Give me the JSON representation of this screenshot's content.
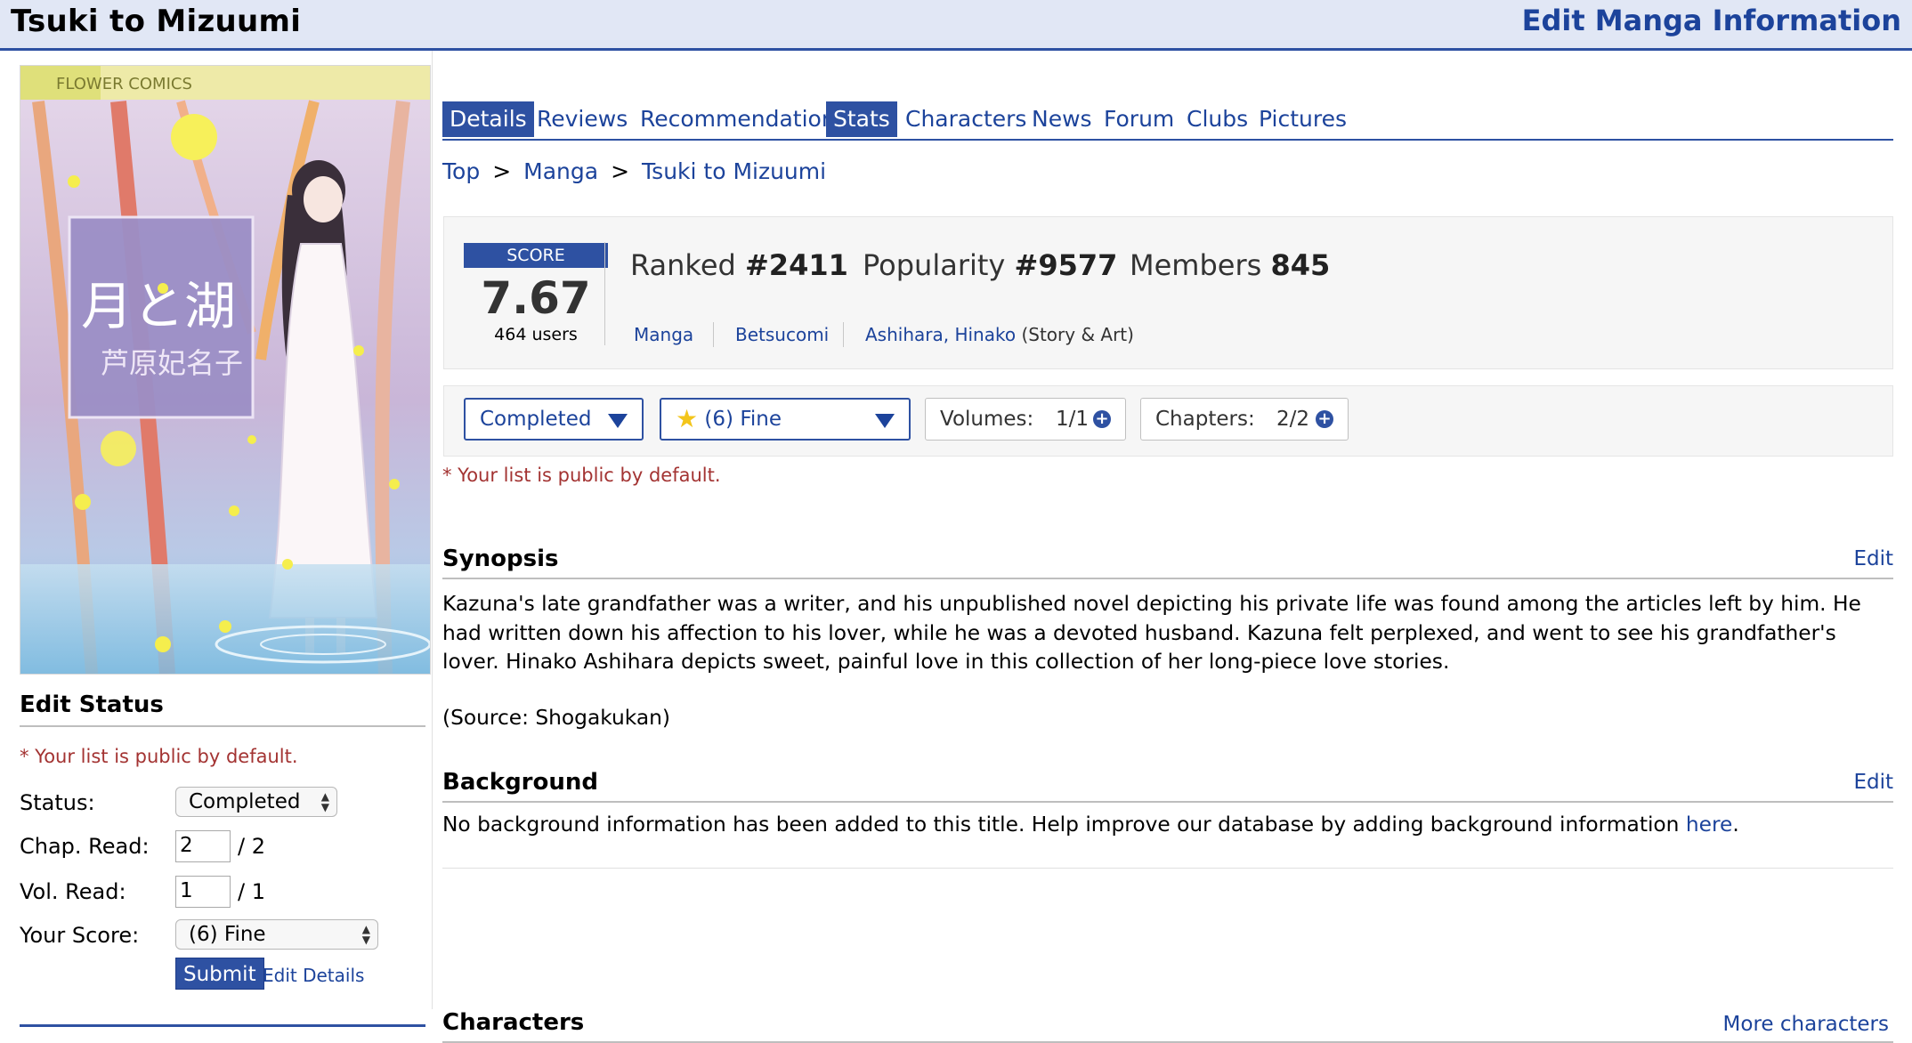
{
  "header": {
    "title": "Tsuki to Mizuumi",
    "edit_link": "Edit Manga Information"
  },
  "tabs": [
    {
      "label": "Details",
      "active": true
    },
    {
      "label": "Reviews",
      "active": false
    },
    {
      "label": "Recommendations",
      "active": false
    },
    {
      "label": "Stats",
      "active": true
    },
    {
      "label": "Characters",
      "active": false
    },
    {
      "label": "News",
      "active": false
    },
    {
      "label": "Forum",
      "active": false
    },
    {
      "label": "Clubs",
      "active": false
    },
    {
      "label": "Pictures",
      "active": false
    }
  ],
  "breadcrumb": {
    "top": "Top",
    "sep": ">",
    "manga": "Manga",
    "title": "Tsuki to Mizuumi"
  },
  "stats": {
    "score_label": "SCORE",
    "score": "7.67",
    "users": "464 users",
    "ranked_label": "Ranked",
    "ranked_value": "#2411",
    "popularity_label": "Popularity",
    "popularity_value": "#9577",
    "members_label": "Members",
    "members_value": "845",
    "type": "Manga",
    "serialization": "Betsucomi",
    "author": "Ashihara, Hinako",
    "author_role": "(Story & Art)"
  },
  "list_controls": {
    "status": "Completed",
    "score": "(6) Fine",
    "volumes_label": "Volumes:",
    "volumes_value": "1/1",
    "chapters_label": "Chapters:",
    "chapters_value": "2/2"
  },
  "public_note": "* Your list is public by default.",
  "cover": {
    "publisher_label": "FLOWER COMICS",
    "title_jp": "月と湖",
    "author_jp": "芦原妃名子"
  },
  "edit_status": {
    "title": "Edit Status",
    "public_note": "* Your list is public by default.",
    "status_label": "Status:",
    "status_value": "Completed",
    "chap_label": "Chap. Read:",
    "chap_value": "2",
    "chap_total": "/ 2",
    "vol_label": "Vol. Read:",
    "vol_value": "1",
    "vol_total": "/ 1",
    "score_label": "Your Score:",
    "score_value": "(6) Fine",
    "submit": "Submit",
    "edit_details": "Edit Details"
  },
  "synopsis": {
    "title": "Synopsis",
    "edit": "Edit",
    "text": "Kazuna's late grandfather was a writer, and his unpublished novel depicting his private life was found among the articles left by him. He had written down his affection to his lover, while he was a devoted husband. Kazuna felt perplexed, and went to see his grandfather's lover. Hinako Ashihara depicts sweet, painful love in this collection of her long-piece love stories.",
    "source": "(Source: Shogakukan)"
  },
  "background": {
    "title": "Background",
    "edit": "Edit",
    "text": "No background information has been added to this title. Help improve our database by adding background information ",
    "link": "here",
    "end": "."
  },
  "characters": {
    "title": "Characters",
    "more": "More characters"
  },
  "colors": {
    "accent": "#2e51a2",
    "header_bg": "#e1e7f5",
    "link": "#1c439b",
    "warning": "#a33332"
  }
}
